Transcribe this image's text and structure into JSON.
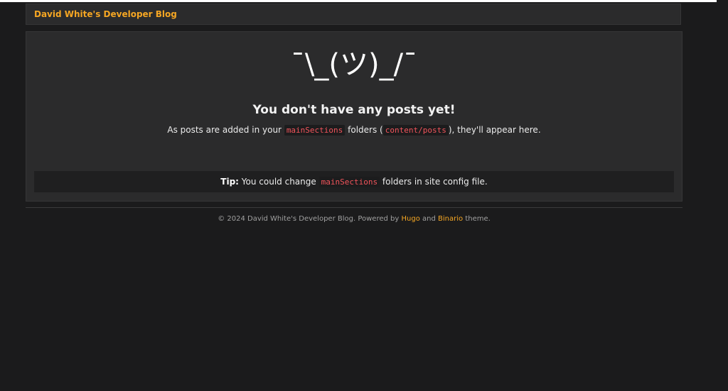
{
  "header": {
    "site_title": "David White's Developer Blog"
  },
  "empty_state": {
    "emoticon": "¯\\_(ツ)_/¯",
    "title": "You don't have any posts yet!",
    "desc_prefix": "As posts are added in your",
    "code_main_sections": "mainSections",
    "desc_middle": "folders (",
    "code_content_posts": "content/posts",
    "desc_suffix": "), they'll appear here."
  },
  "tip": {
    "label": "Tip:",
    "text_prefix": "You could change",
    "code": "mainSections",
    "text_suffix": "folders in site config file."
  },
  "footer": {
    "copyright": "© 2024 David White's Developer Blog. Powered by",
    "hugo_link": "Hugo",
    "and": "and",
    "binario_link": "Binario",
    "theme": "theme."
  },
  "colors": {
    "accent": "#f5a623",
    "code": "#f2545b",
    "background": "#1b1b1c",
    "card": "#2b2b2c"
  }
}
